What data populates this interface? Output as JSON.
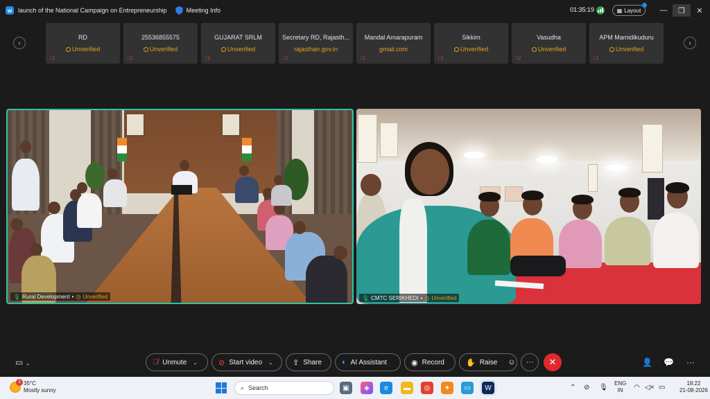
{
  "titlebar": {
    "title": "launch of the National Campaign on Entrepreneurship",
    "meeting_info": "Meeting Info",
    "timer": "01:35:19",
    "layout_label": "Layout"
  },
  "participants": [
    {
      "name": "RD",
      "sub": "Unverified",
      "verified": false
    },
    {
      "name": "25536855575",
      "sub": "Unverified",
      "verified": false
    },
    {
      "name": "GUJARAT SRLM",
      "sub": "Unverified",
      "verified": false
    },
    {
      "name": "Secretary RD, Rajasth...",
      "sub": "rajasthan.gov.in",
      "verified": true
    },
    {
      "name": "Mandal Amarapuram",
      "sub": "gmail.com",
      "verified": true
    },
    {
      "name": "Sikkim",
      "sub": "Unverified",
      "verified": false
    },
    {
      "name": "Vasudha",
      "sub": "Unverified",
      "verified": false
    },
    {
      "name": "APM Mamidikuduru",
      "sub": "Unverified",
      "verified": false
    }
  ],
  "videos": {
    "left": {
      "name": "Rural Development",
      "status": "Unverified"
    },
    "right": {
      "name": "CMTC SERIKHEDI",
      "status": "Unverified"
    }
  },
  "toolbar": {
    "unmute": "Unmute",
    "start_video": "Start video",
    "share": "Share",
    "ai_assistant": "AI Assistant",
    "record": "Record",
    "raise": "Raise"
  },
  "taskbar": {
    "temperature": "35°C",
    "weather": "Mostly sunny",
    "weather_badge": "3",
    "search_placeholder": "Search",
    "lang_line1": "ENG",
    "lang_line2": "IN",
    "time": "18:22",
    "date": "21-08-2026"
  },
  "colors": {
    "accent": "#2ec4a8",
    "unverified": "#e0a020",
    "end_call": "#e0282e",
    "webex_blue": "#1f8ae6"
  }
}
